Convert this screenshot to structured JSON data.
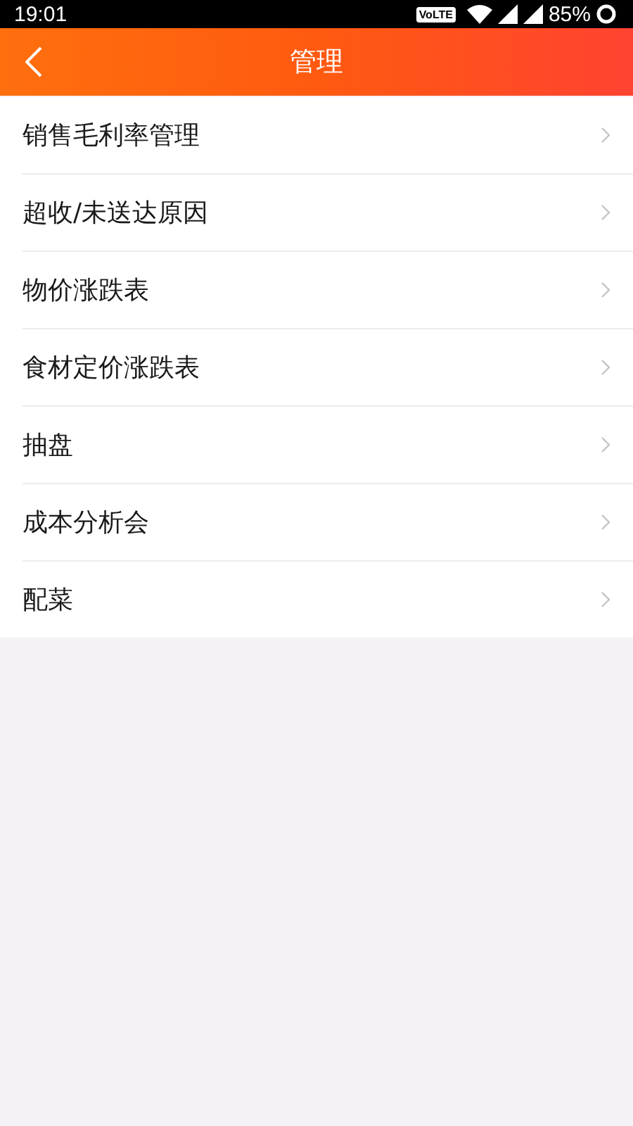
{
  "status_bar": {
    "time": "19:01",
    "network_badge": "VoLTE",
    "battery": "85%"
  },
  "header": {
    "title": "管理"
  },
  "menu_items": [
    {
      "label": "销售毛利率管理"
    },
    {
      "label": "超收/未送达原因"
    },
    {
      "label": "物价涨跌表"
    },
    {
      "label": "食材定价涨跌表"
    },
    {
      "label": "抽盘"
    },
    {
      "label": "成本分析会"
    },
    {
      "label": "配菜"
    }
  ]
}
